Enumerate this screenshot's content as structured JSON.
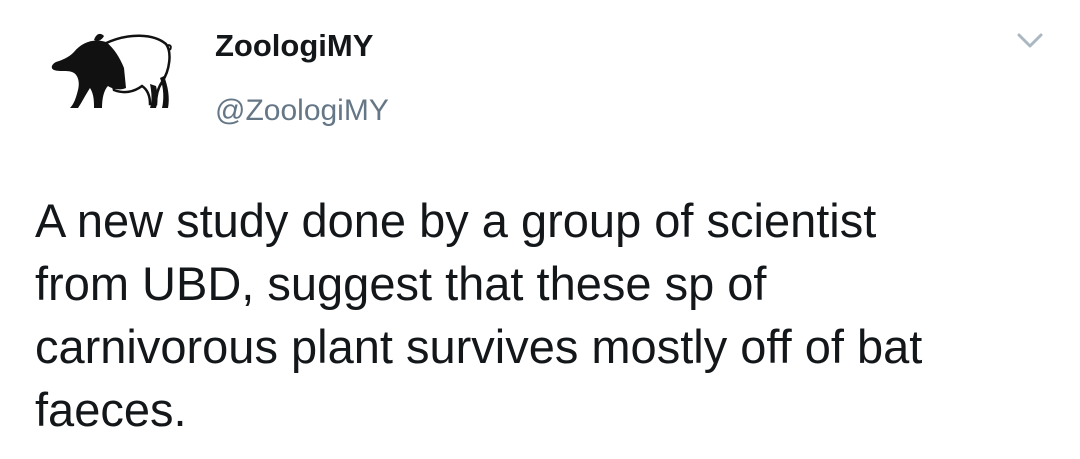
{
  "tweet": {
    "author": {
      "display_name": "ZoologiMY",
      "handle": "@ZoologiMY",
      "avatar_icon": "tapir-logo-icon"
    },
    "menu_icon": "chevron-down-icon",
    "text": "A new study done by a group of scientist\nfrom UBD, suggest that these sp of\ncarnivorous plant survives mostly off of bat\nfaeces."
  },
  "colors": {
    "text": "#14171a",
    "secondary_text": "#657786",
    "caret": "#aab8c2",
    "background": "#ffffff"
  }
}
